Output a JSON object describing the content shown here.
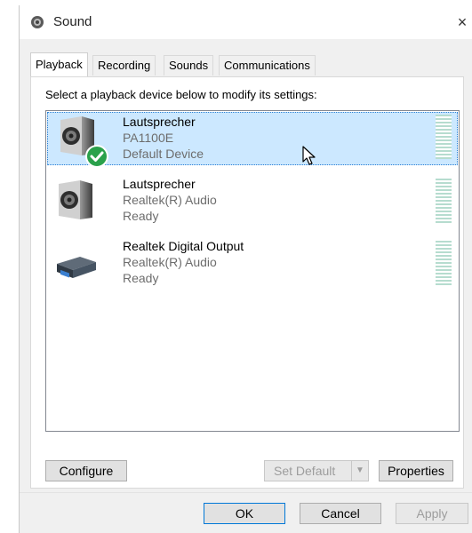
{
  "window": {
    "title": "Sound",
    "close_glyph": "×"
  },
  "tabs": [
    {
      "label": "Playback",
      "active": true
    },
    {
      "label": "Recording",
      "active": false
    },
    {
      "label": "Sounds",
      "active": false
    },
    {
      "label": "Communications",
      "active": false
    }
  ],
  "instructions": "Select a playback device below to modify its settings:",
  "devices": [
    {
      "name": "Lautsprecher",
      "description": "PA1100E",
      "status": "Default Device",
      "icon": "speaker-icon",
      "selected": true,
      "default_badge": "check-badge-icon"
    },
    {
      "name": "Lautsprecher",
      "description": "Realtek(R) Audio",
      "status": "Ready",
      "icon": "speaker-icon",
      "selected": false
    },
    {
      "name": "Realtek Digital Output",
      "description": "Realtek(R) Audio",
      "status": "Ready",
      "icon": "digital-output-icon",
      "selected": false
    }
  ],
  "buttons": {
    "configure": "Configure",
    "set_default": "Set Default",
    "properties": "Properties",
    "ok": "OK",
    "cancel": "Cancel",
    "apply": "Apply"
  },
  "colors": {
    "selection": "#cce8ff",
    "selection_border": "#2a7fd4",
    "default_badge": "#2aa14b",
    "meter": "#b6dccf"
  }
}
